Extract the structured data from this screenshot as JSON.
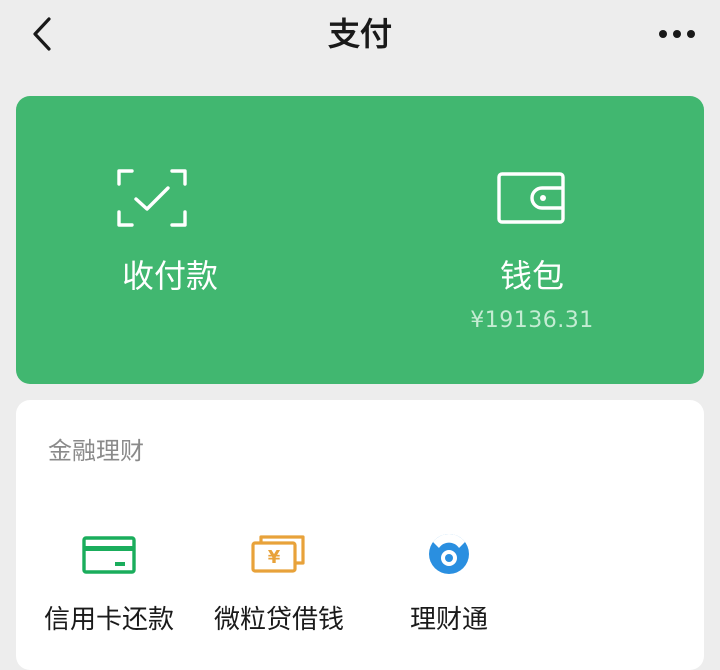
{
  "nav": {
    "back_icon": "chevron-left-icon",
    "title": "支付",
    "more_icon": "more-horizontal-icon"
  },
  "hero": {
    "background": "#41b770",
    "pay_receive": {
      "label": "收付款",
      "icon": "scan-check-icon"
    },
    "wallet": {
      "label": "钱包",
      "amount": "¥19136.31",
      "icon": "wallet-icon"
    }
  },
  "finance": {
    "title": "金融理财",
    "items": [
      {
        "label": "信用卡还款",
        "icon": "credit-card-icon",
        "color": "#1aad5c"
      },
      {
        "label": "微粒贷借钱",
        "icon": "banknote-icon",
        "color": "#e8a23a"
      },
      {
        "label": "理财通",
        "icon": "licaitong-icon",
        "color": "#2a8fe0"
      }
    ]
  }
}
